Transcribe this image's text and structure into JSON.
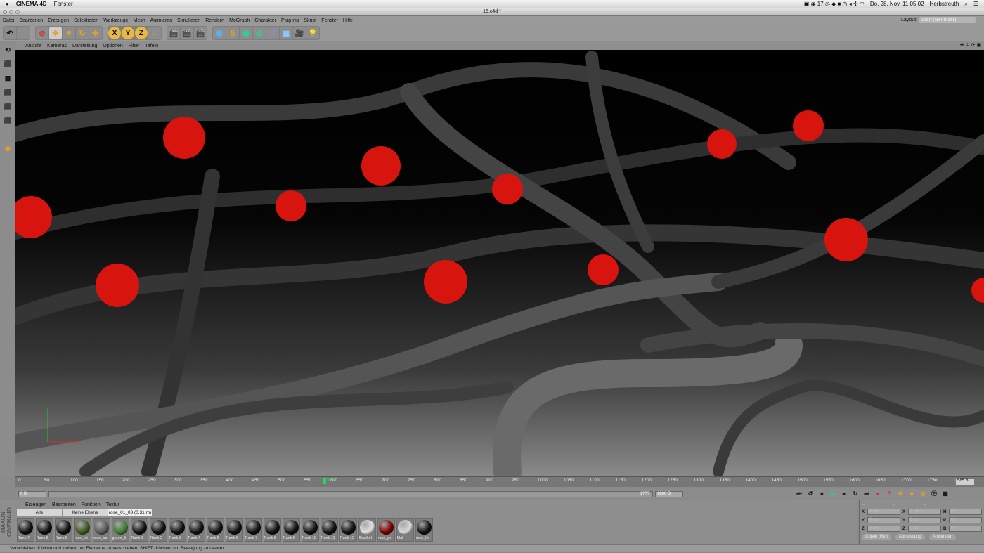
{
  "macbar": {
    "app": "CINEMA 4D",
    "menu": "Fenster",
    "clock": "Do. 28. Nov.  11:05:02",
    "user": "Herbstreuth",
    "badge": "17"
  },
  "window": {
    "title": "16.c4d *"
  },
  "menu": [
    "Datei",
    "Bearbeiten",
    "Erzeugen",
    "Selektieren",
    "Werkzeuge",
    "Mesh",
    "Animieren",
    "Simulieren",
    "Rendern",
    "MoGraph",
    "Charakter",
    "Plug-ins",
    "Skript",
    "Fenster",
    "Hilfe"
  ],
  "layout": {
    "label": "Layout:",
    "value": "Start (Benutzer)"
  },
  "toolbar": {
    "axis_x": "X",
    "axis_y": "Y",
    "axis_z": "Z"
  },
  "viewport_menu": [
    "Ansicht",
    "Kameras",
    "Darstellung",
    "Optionen",
    "Filter",
    "Tafeln"
  ],
  "timeline": {
    "ticks": [
      0,
      50,
      100,
      150,
      200,
      250,
      300,
      350,
      400,
      450,
      500,
      550,
      600,
      650,
      700,
      750,
      800,
      850,
      900,
      950,
      1000,
      1050,
      1100,
      1150,
      1200,
      1250,
      1300,
      1350,
      1400,
      1450,
      1500,
      1550,
      1600,
      1650,
      1700,
      1750,
      1800
    ],
    "current_frame": 583,
    "current_label": "583",
    "end_field": "585 B",
    "min": 0,
    "max": 1800
  },
  "frame_row": {
    "start": "0 B",
    "end": "1800 B",
    "range_hint": "1???"
  },
  "material_manager": {
    "menu": [
      "Erzeugen",
      "Bearbeiten",
      "Funktion",
      "Textur"
    ],
    "filters": [
      "Alle",
      "Keine Ebene",
      "rose_01_03 (0.31 m)"
    ],
    "materials": [
      {
        "name": "Rank 7",
        "color": "#111111"
      },
      {
        "name": "Rank 5",
        "color": "#111111"
      },
      {
        "name": "Rank 8",
        "color": "#111111"
      },
      {
        "name": "rose_lei",
        "color": "#3c5a1e"
      },
      {
        "name": "rose_ba",
        "color": "#5a5a5a"
      },
      {
        "name": "green_li",
        "color": "#3f7a32"
      },
      {
        "name": "Rank 1",
        "color": "#111111"
      },
      {
        "name": "Rank 2",
        "color": "#111111"
      },
      {
        "name": "Rank 3",
        "color": "#111111"
      },
      {
        "name": "Rank 4",
        "color": "#111111"
      },
      {
        "name": "Rank 5",
        "color": "#111111"
      },
      {
        "name": "Rank 6",
        "color": "#111111"
      },
      {
        "name": "Rank 7",
        "color": "#111111"
      },
      {
        "name": "Rank 8",
        "color": "#111111"
      },
      {
        "name": "Rank 9",
        "color": "#111111"
      },
      {
        "name": "Rank 10",
        "color": "#111111"
      },
      {
        "name": "Rank 11",
        "color": "#111111"
      },
      {
        "name": "Rank 12",
        "color": "#111111"
      },
      {
        "name": "Stachel",
        "color": "#e0e0e0"
      },
      {
        "name": "rose_pe",
        "color": "#7a0000"
      },
      {
        "name": "Mat",
        "color": "#d8d8d8"
      },
      {
        "name": "rose_lei",
        "color": "#111111"
      }
    ]
  },
  "coordinates": {
    "header": [
      "--",
      "--",
      "--"
    ],
    "rows": [
      {
        "a": "X",
        "av": "0 cm",
        "b": "X",
        "bv": "0 cm",
        "c": "H",
        "cv": "0 °"
      },
      {
        "a": "Y",
        "av": "0 cm",
        "b": "Y",
        "bv": "0 cm",
        "c": "P",
        "cv": "0 °"
      },
      {
        "a": "Z",
        "av": "0 cm",
        "b": "Z",
        "bv": "0 cm",
        "c": "B",
        "cv": "0 °"
      }
    ],
    "mode": "Objekt (Rel)",
    "size": "Abmessung",
    "apply": "Anwenden"
  },
  "status": "Verschieben: Klicken und ziehen, um Elemente zu verschieben. SHIFT drücken, um Bewegung zu rastern.",
  "maxon": "MAXON CINEMA 4D",
  "colors": {
    "rose": "#d8140f",
    "accent": "#2bd46a"
  }
}
